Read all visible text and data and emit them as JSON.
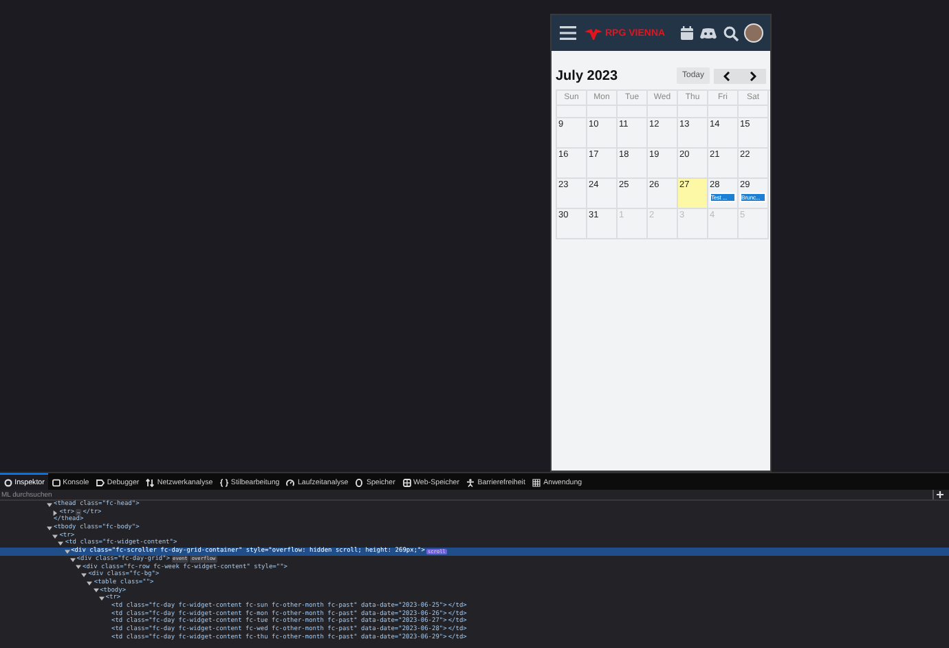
{
  "app_header": {
    "logo_text": "RPG VIENNA"
  },
  "calendar": {
    "title": "July 2023",
    "today_button": "Today",
    "weekdays": [
      "Sun",
      "Mon",
      "Tue",
      "Wed",
      "Thu",
      "Fri",
      "Sat"
    ],
    "weeks": [
      {
        "kind": "blank"
      },
      {
        "kind": "dates",
        "days": [
          {
            "date": "9",
            "today": false,
            "other_month": false
          },
          {
            "date": "10",
            "today": false,
            "other_month": false
          },
          {
            "date": "11",
            "today": false,
            "other_month": false
          },
          {
            "date": "12",
            "today": false,
            "other_month": false
          },
          {
            "date": "13",
            "today": false,
            "other_month": false
          },
          {
            "date": "14",
            "today": false,
            "other_month": false
          },
          {
            "date": "15",
            "today": false,
            "other_month": false
          }
        ]
      },
      {
        "kind": "dates",
        "days": [
          {
            "date": "16",
            "today": false,
            "other_month": false
          },
          {
            "date": "17",
            "today": false,
            "other_month": false
          },
          {
            "date": "18",
            "today": false,
            "other_month": false
          },
          {
            "date": "19",
            "today": false,
            "other_month": false
          },
          {
            "date": "20",
            "today": false,
            "other_month": false
          },
          {
            "date": "21",
            "today": false,
            "other_month": false
          },
          {
            "date": "22",
            "today": false,
            "other_month": false
          }
        ]
      },
      {
        "kind": "dates",
        "days": [
          {
            "date": "23",
            "today": false,
            "other_month": false
          },
          {
            "date": "24",
            "today": false,
            "other_month": false
          },
          {
            "date": "25",
            "today": false,
            "other_month": false
          },
          {
            "date": "26",
            "today": false,
            "other_month": false
          },
          {
            "date": "27",
            "today": true,
            "other_month": false
          },
          {
            "date": "28",
            "today": false,
            "other_month": false,
            "events": [
              "Test ..."
            ]
          },
          {
            "date": "29",
            "today": false,
            "other_month": false,
            "events": [
              "Brunc..."
            ]
          }
        ]
      },
      {
        "kind": "dates",
        "days": [
          {
            "date": "30",
            "today": false,
            "other_month": false
          },
          {
            "date": "31",
            "today": false,
            "other_month": false
          },
          {
            "date": "1",
            "today": false,
            "other_month": true
          },
          {
            "date": "2",
            "today": false,
            "other_month": true
          },
          {
            "date": "3",
            "today": false,
            "other_month": true
          },
          {
            "date": "4",
            "today": false,
            "other_month": true
          },
          {
            "date": "5",
            "today": false,
            "other_month": true
          }
        ]
      }
    ]
  },
  "devtools": {
    "tabs": [
      {
        "label": "Inspektor",
        "selected": true
      },
      {
        "label": "Konsole",
        "selected": false
      },
      {
        "label": "Debugger",
        "selected": false
      },
      {
        "label": "Netzwerkanalyse",
        "selected": false
      },
      {
        "label": "Stilbearbeitung",
        "selected": false
      },
      {
        "label": "Laufzeitanalyse",
        "selected": false
      },
      {
        "label": "Speicher",
        "selected": false
      },
      {
        "label": "Web-Speicher",
        "selected": false
      },
      {
        "label": "Barrierefreiheit",
        "selected": false
      },
      {
        "label": "Anwendung",
        "selected": false
      }
    ],
    "search": {
      "placeholder": "ML durchsuchen"
    },
    "tree": [
      {
        "tag": "<thead class=\"fc-head\">",
        "expanded": true,
        "selected": false,
        "close": "</thead>",
        "children": [
          {
            "tag": "<tr>",
            "expanded": false,
            "selected": false,
            "badges": [
              "…"
            ],
            "close": "</tr>"
          }
        ]
      },
      {
        "tag": "<tbody class=\"fc-body\">",
        "expanded": true,
        "selected": false,
        "children": [
          {
            "tag": "<tr>",
            "expanded": true,
            "selected": false,
            "children": [
              {
                "tag": "<td class=\"fc-widget-content\">",
                "expanded": true,
                "selected": false,
                "children": [
                  {
                    "tag": "<div class=\"fc-scroller fc-day-grid-container\" style=\"overflow: hidden scroll; height: 269px;\">",
                    "expanded": true,
                    "selected": true,
                    "badges": [
                      "scroll"
                    ],
                    "children": [
                      {
                        "tag": "<div class=\"fc-day-grid\">",
                        "expanded": true,
                        "selected": false,
                        "badges": [
                          "event",
                          "overflow"
                        ],
                        "children": [
                          {
                            "tag": "<div class=\"fc-row fc-week fc-widget-content\" style=\"\">",
                            "expanded": true,
                            "selected": false,
                            "children": [
                              {
                                "tag": "<div class=\"fc-bg\">",
                                "expanded": true,
                                "selected": false,
                                "children": [
                                  {
                                    "tag": "<table class=\"\">",
                                    "expanded": true,
                                    "selected": false,
                                    "children": [
                                      {
                                        "tag": "<tbody>",
                                        "expanded": true,
                                        "selected": false,
                                        "children": [
                                          {
                                            "tag": "<tr>",
                                            "expanded": true,
                                            "selected": false,
                                            "children": [
                                              {
                                                "tag": "<td class=\"fc-day fc-widget-content fc-sun fc-other-month fc-past\" data-date=\"2023-06-25\">",
                                                "selected": false,
                                                "close": "</td>"
                                              },
                                              {
                                                "tag": "<td class=\"fc-day fc-widget-content fc-mon fc-other-month fc-past\" data-date=\"2023-06-26\">",
                                                "selected": false,
                                                "close": "</td>"
                                              },
                                              {
                                                "tag": "<td class=\"fc-day fc-widget-content fc-tue fc-other-month fc-past\" data-date=\"2023-06-27\">",
                                                "selected": false,
                                                "close": "</td>"
                                              },
                                              {
                                                "tag": "<td class=\"fc-day fc-widget-content fc-wed fc-other-month fc-past\" data-date=\"2023-06-28\">",
                                                "selected": false,
                                                "close": "</td>"
                                              },
                                              {
                                                "tag": "<td class=\"fc-day fc-widget-content fc-thu fc-other-month fc-past\" data-date=\"2023-06-29\">",
                                                "selected": false,
                                                "close": "</td>"
                                              }
                                            ]
                                          }
                                        ]
                                      }
                                    ]
                                  }
                                ]
                              }
                            ]
                          }
                        ]
                      }
                    ]
                  }
                ]
              }
            ]
          }
        ]
      }
    ]
  }
}
